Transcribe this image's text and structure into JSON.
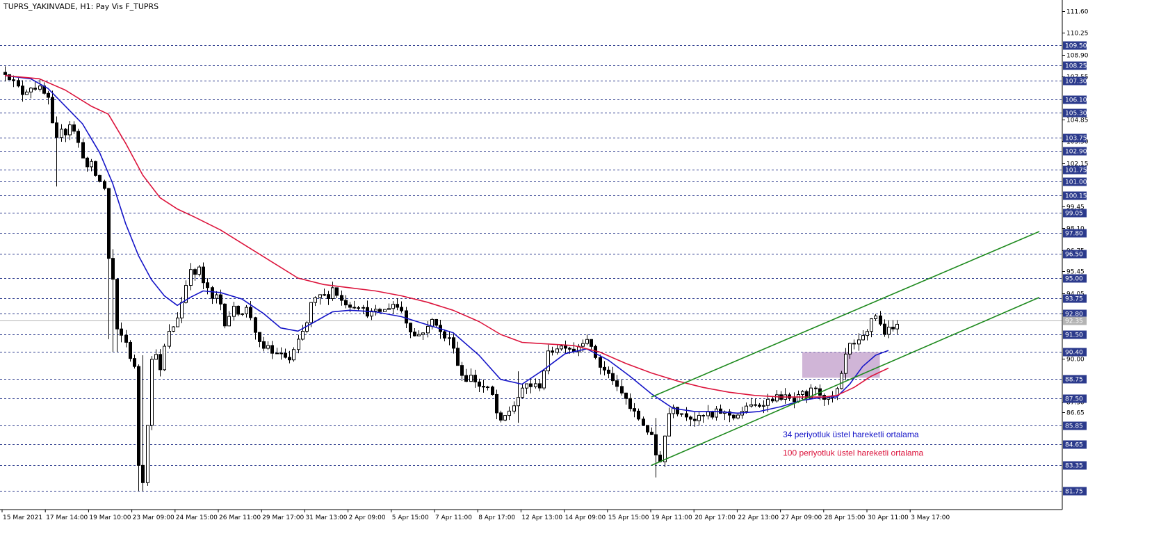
{
  "header": {
    "title": "TUPRS_YAKINVADE, H1:  Pay Vis F_TUPRS"
  },
  "colors": {
    "background": "#ffffff",
    "ema34": "#1515c8",
    "ema100": "#dc143c",
    "channel": "#1e8a1e",
    "zone": "#c8a8d0",
    "level_line": "#2b3a8c",
    "current_price_line": "#b4b4b4",
    "candle": "#000000"
  },
  "chart_data": {
    "type": "candlestick",
    "symbol": "TUPRS_YAKINVADE",
    "timeframe": "H1",
    "ylim": [
      80.6,
      112.3
    ],
    "y_ticks": [
      "111.60",
      "110.25",
      "108.90",
      "107.55",
      "104.85",
      "103.50",
      "102.15",
      "99.45",
      "98.10",
      "96.75",
      "95.45",
      "94.05",
      "92.80",
      "90.00",
      "87.30",
      "86.65"
    ],
    "level_lines": [
      "109.50",
      "108.25",
      "107.30",
      "106.10",
      "105.30",
      "103.75",
      "102.90",
      "101.75",
      "101.00",
      "100.15",
      "99.05",
      "97.80",
      "96.50",
      "95.00",
      "93.75",
      "92.80",
      "91.50",
      "90.40",
      "88.75",
      "87.50",
      "85.85",
      "84.65",
      "83.35",
      "81.75"
    ],
    "current_price": "92.35",
    "x_labels": [
      "15 Mar 2021",
      "17 Mar 14:00",
      "19 Mar 10:00",
      "23 Mar 09:00",
      "24 Mar 15:00",
      "26 Mar 11:00",
      "29 Mar 17:00",
      "31 Mar 13:00",
      "2 Apr 09:00",
      "5 Apr 15:00",
      "7 Apr 11:00",
      "8 Apr 17:00",
      "12 Apr 13:00",
      "14 Apr 09:00",
      "15 Apr 15:00",
      "19 Apr 11:00",
      "20 Apr 17:00",
      "22 Apr 13:00",
      "27 Apr 09:00",
      "28 Apr 15:00",
      "30 Apr 11:00",
      "3 May 17:00"
    ],
    "price_path": [
      [
        0,
        107.8
      ],
      [
        2,
        107.2
      ],
      [
        4,
        106.5
      ],
      [
        6,
        106.9
      ],
      [
        8,
        106.8
      ],
      [
        10,
        106.1
      ],
      [
        11,
        104.5
      ],
      [
        12,
        103.6
      ],
      [
        13,
        104.4
      ],
      [
        14,
        104.0
      ],
      [
        15,
        104.6
      ],
      [
        16,
        104.1
      ],
      [
        17,
        103.4
      ],
      [
        18,
        102.6
      ],
      [
        19,
        101.9
      ],
      [
        20,
        102.1
      ],
      [
        21,
        101.4
      ],
      [
        22,
        101.0
      ],
      [
        23,
        100.6
      ],
      [
        24,
        96.2
      ],
      [
        25,
        94.9
      ],
      [
        26,
        91.7
      ],
      [
        27,
        91.4
      ],
      [
        28,
        91.0
      ],
      [
        29,
        90.1
      ],
      [
        30,
        89.4
      ],
      [
        31,
        83.4
      ],
      [
        32,
        82.4
      ],
      [
        33,
        86.0
      ],
      [
        34,
        89.9
      ],
      [
        35,
        90.4
      ],
      [
        36,
        89.2
      ],
      [
        37,
        90.7
      ],
      [
        38,
        91.6
      ],
      [
        39,
        92.0
      ],
      [
        40,
        92.6
      ],
      [
        41,
        93.5
      ],
      [
        42,
        94.6
      ],
      [
        43,
        95.7
      ],
      [
        44,
        95.1
      ],
      [
        45,
        95.7
      ],
      [
        46,
        94.6
      ],
      [
        47,
        94.4
      ],
      [
        48,
        93.6
      ],
      [
        49,
        93.9
      ],
      [
        50,
        93.4
      ],
      [
        51,
        92.2
      ],
      [
        52,
        92.7
      ],
      [
        53,
        93.1
      ],
      [
        54,
        92.9
      ],
      [
        55,
        92.9
      ],
      [
        56,
        93.1
      ],
      [
        57,
        92.6
      ],
      [
        58,
        91.7
      ],
      [
        59,
        90.9
      ],
      [
        60,
        90.5
      ],
      [
        61,
        90.8
      ],
      [
        62,
        90.3
      ],
      [
        63,
        90.4
      ],
      [
        64,
        90.2
      ],
      [
        65,
        90.1
      ],
      [
        66,
        89.9
      ],
      [
        70,
        92.2
      ],
      [
        71,
        93.4
      ],
      [
        73,
        93.9
      ],
      [
        75,
        93.9
      ],
      [
        76,
        94.4
      ],
      [
        78,
        93.6
      ],
      [
        80,
        93.3
      ],
      [
        82,
        93.3
      ],
      [
        84,
        92.8
      ],
      [
        86,
        92.9
      ],
      [
        88,
        93.0
      ],
      [
        89,
        93.2
      ],
      [
        90,
        93.4
      ],
      [
        92,
        93.0
      ],
      [
        93,
        92.3
      ],
      [
        94,
        91.8
      ],
      [
        95,
        91.4
      ],
      [
        96,
        91.5
      ],
      [
        98,
        91.9
      ],
      [
        99,
        92.4
      ],
      [
        100,
        92.2
      ],
      [
        101,
        91.6
      ],
      [
        102,
        91.3
      ],
      [
        103,
        91.2
      ],
      [
        104,
        90.8
      ],
      [
        105,
        89.6
      ],
      [
        106,
        89.0
      ],
      [
        107,
        88.7
      ],
      [
        108,
        88.9
      ],
      [
        110,
        88.3
      ],
      [
        112,
        88.1
      ],
      [
        113,
        87.7
      ],
      [
        114,
        86.6
      ],
      [
        115,
        86.0
      ],
      [
        116,
        86.4
      ],
      [
        118,
        87.1
      ],
      [
        119,
        87.6
      ],
      [
        120,
        88.0
      ],
      [
        121,
        88.4
      ],
      [
        122,
        88.3
      ],
      [
        124,
        88.3
      ],
      [
        125,
        89.3
      ],
      [
        126,
        90.3
      ],
      [
        128,
        90.7
      ],
      [
        130,
        90.8
      ],
      [
        132,
        90.5
      ],
      [
        133,
        90.8
      ],
      [
        134,
        91.1
      ],
      [
        135,
        91.3
      ],
      [
        136,
        90.6
      ],
      [
        137,
        90.1
      ],
      [
        138,
        89.5
      ],
      [
        140,
        89.0
      ],
      [
        141,
        88.7
      ],
      [
        142,
        88.1
      ],
      [
        144,
        87.5
      ],
      [
        145,
        86.9
      ],
      [
        146,
        86.6
      ],
      [
        148,
        85.9
      ],
      [
        150,
        85.1
      ],
      [
        151,
        84.0
      ],
      [
        152,
        83.7
      ],
      [
        153,
        85.2
      ],
      [
        154,
        86.6
      ],
      [
        155,
        87.1
      ],
      [
        156,
        86.7
      ],
      [
        158,
        86.5
      ],
      [
        160,
        86.2
      ],
      [
        162,
        86.4
      ],
      [
        163,
        86.6
      ],
      [
        164,
        86.3
      ],
      [
        165,
        86.7
      ],
      [
        167,
        86.6
      ],
      [
        169,
        86.4
      ],
      [
        171,
        86.6
      ],
      [
        172,
        87.1
      ],
      [
        173,
        87.0
      ],
      [
        175,
        87.1
      ],
      [
        177,
        87.4
      ],
      [
        179,
        87.6
      ],
      [
        181,
        87.6
      ],
      [
        183,
        87.3
      ],
      [
        184,
        87.6
      ],
      [
        185,
        87.8
      ],
      [
        186,
        87.4
      ],
      [
        187,
        88.2
      ],
      [
        188,
        88.0
      ],
      [
        189,
        87.8
      ],
      [
        190,
        87.6
      ],
      [
        191,
        87.4
      ],
      [
        192,
        87.6
      ],
      [
        193,
        88.0
      ],
      [
        194,
        88.9
      ],
      [
        195,
        90.2
      ],
      [
        196,
        90.8
      ],
      [
        197,
        90.8
      ],
      [
        198,
        91.0
      ],
      [
        199,
        91.3
      ],
      [
        200,
        91.6
      ],
      [
        201,
        92.5
      ],
      [
        202,
        92.7
      ],
      [
        203,
        92.1
      ],
      [
        204,
        91.6
      ],
      [
        205,
        91.8
      ],
      [
        206,
        91.8
      ],
      [
        207,
        92.3
      ]
    ],
    "series": [
      {
        "name": "34 periyotluk üstel hareketli ortalama",
        "color": "#1515c8",
        "values": [
          [
            0,
            107.6
          ],
          [
            6,
            107.4
          ],
          [
            10,
            106.8
          ],
          [
            14,
            105.7
          ],
          [
            18,
            104.6
          ],
          [
            22,
            102.8
          ],
          [
            25,
            100.9
          ],
          [
            28,
            98.4
          ],
          [
            31,
            96.4
          ],
          [
            34,
            94.9
          ],
          [
            37,
            93.9
          ],
          [
            40,
            93.3
          ],
          [
            43,
            93.8
          ],
          [
            46,
            94.2
          ],
          [
            50,
            94.1
          ],
          [
            55,
            93.7
          ],
          [
            60,
            92.8
          ],
          [
            64,
            91.9
          ],
          [
            68,
            91.7
          ],
          [
            72,
            92.3
          ],
          [
            76,
            92.9
          ],
          [
            80,
            93.0
          ],
          [
            86,
            92.9
          ],
          [
            92,
            92.6
          ],
          [
            98,
            92.1
          ],
          [
            104,
            91.6
          ],
          [
            110,
            90.2
          ],
          [
            115,
            88.7
          ],
          [
            120,
            88.4
          ],
          [
            125,
            89.3
          ],
          [
            130,
            90.3
          ],
          [
            135,
            90.6
          ],
          [
            140,
            89.9
          ],
          [
            145,
            88.9
          ],
          [
            150,
            87.8
          ],
          [
            155,
            86.9
          ],
          [
            160,
            86.7
          ],
          [
            165,
            86.7
          ],
          [
            170,
            86.6
          ],
          [
            175,
            86.7
          ],
          [
            180,
            87.0
          ],
          [
            185,
            87.4
          ],
          [
            190,
            87.6
          ],
          [
            193,
            87.6
          ],
          [
            196,
            88.4
          ],
          [
            199,
            89.5
          ],
          [
            202,
            90.2
          ],
          [
            205,
            90.5
          ]
        ]
      },
      {
        "name": "100 periyotluk üstel hareketli ortalama",
        "color": "#dc143c",
        "values": [
          [
            0,
            107.6
          ],
          [
            8,
            107.4
          ],
          [
            14,
            106.7
          ],
          [
            20,
            105.7
          ],
          [
            24,
            105.2
          ],
          [
            28,
            103.4
          ],
          [
            32,
            101.4
          ],
          [
            36,
            100.0
          ],
          [
            40,
            99.3
          ],
          [
            44,
            98.8
          ],
          [
            50,
            98.0
          ],
          [
            56,
            97.0
          ],
          [
            62,
            96.0
          ],
          [
            68,
            95.0
          ],
          [
            74,
            94.6
          ],
          [
            80,
            94.4
          ],
          [
            86,
            94.2
          ],
          [
            92,
            93.9
          ],
          [
            98,
            93.5
          ],
          [
            104,
            93.0
          ],
          [
            110,
            92.3
          ],
          [
            115,
            91.5
          ],
          [
            120,
            91.0
          ],
          [
            126,
            90.9
          ],
          [
            132,
            90.8
          ],
          [
            138,
            90.4
          ],
          [
            144,
            89.7
          ],
          [
            150,
            89.1
          ],
          [
            156,
            88.6
          ],
          [
            162,
            88.2
          ],
          [
            168,
            87.9
          ],
          [
            174,
            87.7
          ],
          [
            180,
            87.6
          ],
          [
            186,
            87.6
          ],
          [
            190,
            87.6
          ],
          [
            193,
            87.7
          ],
          [
            197,
            88.2
          ],
          [
            201,
            88.9
          ],
          [
            205,
            89.4
          ]
        ]
      }
    ],
    "channel_lines": [
      {
        "from": [
          150,
          83.35
        ],
        "to": [
          240,
          93.8
        ]
      },
      {
        "from": [
          150,
          87.6
        ],
        "to": [
          240,
          97.9
        ]
      }
    ],
    "zone": {
      "x_from": 185,
      "x_to": 203,
      "y_from": 88.8,
      "y_to": 90.4
    },
    "annotations": [
      {
        "text": "34 periyotluk üstel hareketli ortalama",
        "color": "#1515c8",
        "bar": 180.5,
        "price": 85.1
      },
      {
        "text": "100 periyotluk üstel hareketli ortalama",
        "color": "#dc143c",
        "bar": 180.5,
        "price": 83.95
      }
    ]
  }
}
